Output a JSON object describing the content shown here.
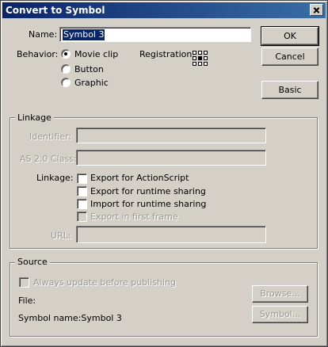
{
  "window": {
    "title": "Convert to Symbol"
  },
  "name_field": {
    "label": "Name:",
    "value": "Symbol 3"
  },
  "behavior": {
    "label": "Behavior:",
    "options": [
      "Movie clip",
      "Button",
      "Graphic"
    ],
    "selected": "Movie clip"
  },
  "registration": {
    "label": "Registration:",
    "icon": "registration-grid-icon"
  },
  "buttons": {
    "ok": "OK",
    "cancel": "Cancel",
    "basic": "Basic"
  },
  "linkage": {
    "group_title": "Linkage",
    "identifier_label": "Identifier:",
    "identifier_value": "",
    "class_label": "AS 2.0 Class:",
    "class_value": "",
    "linkage_label": "Linkage:",
    "options": [
      {
        "label": "Export for ActionScript",
        "checked": false,
        "enabled": true
      },
      {
        "label": "Export for runtime sharing",
        "checked": false,
        "enabled": true
      },
      {
        "label": "Import for runtime sharing",
        "checked": false,
        "enabled": true
      },
      {
        "label": "Export in first frame",
        "checked": false,
        "enabled": false
      }
    ],
    "url_label": "URL:",
    "url_value": ""
  },
  "source": {
    "group_title": "Source",
    "always_update_label": "Always update before publishing",
    "file_label": "File:",
    "symbol_name_text": "Symbol name:Symbol 3",
    "browse_button": "Browse...",
    "symbol_button": "Symbol..."
  },
  "colors": {
    "titlebar_start": "#0a246a",
    "titlebar_end": "#3a6ea5",
    "dialog_face": "#d4d0c8",
    "disabled_text": "#9c9a94"
  }
}
